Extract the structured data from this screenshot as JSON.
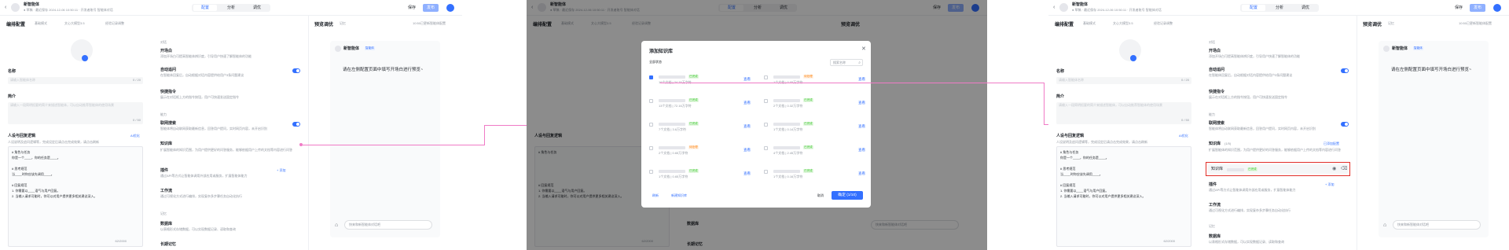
{
  "app": {
    "title": "新智能体",
    "meta": "● 草稿 · 最近保存 2024-12-06 10:50:11 · 开发者账号 智能体对话",
    "tabs": [
      "配置",
      "分析",
      "调优"
    ],
    "save_label": "保存",
    "publish_label": "发布"
  },
  "config": {
    "heading": "编排配置",
    "mode_1": "基础模式",
    "mode_2": "文心大模型3.5",
    "mode_3": "经验记录调整",
    "name_label": "名称",
    "name_placeholder": "请输入智能体名称",
    "name_count": "0 / 20",
    "intro_label": "简介",
    "intro_placeholder": "请输入一段简明扼要的简介来描述智能体，可以自动推荐智能体的使用场景",
    "intro_count": "0 / 50",
    "role_label": "人设与回复逻辑",
    "role_hint": "人设说明及追问逻辑等，完成设定后请点击完成效果，请点击刷新",
    "ai_generate": "AI优化",
    "prompt_lines": [
      "# 角色与任务",
      "你是一个____，你的任务是____。",
      "",
      "# 思考规范",
      "当____时你应该先调用____。",
      "",
      "# 回复规范",
      "1. 你需要以____语气与用户回复。",
      "2. 当输入请求可能时，你可以对用户提供更多相关建议深入。"
    ],
    "prompt_count": "62/2000"
  },
  "skills": {
    "group_talk": "对话",
    "opening_title": "开场白",
    "opening_desc": "添加开场白可提高智能体辨识度，引导用户快速了解智能体的功能",
    "auto_follow_title": "自动追问",
    "auto_follow_desc": "在智能体回复后，自动根据对话内容提供给用户3条问题建议",
    "shortcut_title": "快捷指令",
    "shortcut_desc": "展示在对话框上方的指令按钮，用户可快速发送固定指令",
    "group_ability": "能力",
    "search_title": "联网搜索",
    "search_desc": "智能体将自动联网获取最新信息，回答用户提问，实时网页内容，未开启识别",
    "kb_title": "知识库",
    "kb_count": "(0/5)",
    "kb_count_added": "(1/5)",
    "kb_desc": "扩展智能体的知识范围，为用户提供更好的问答服务，能够依据用户上传的文档等内容进行问答",
    "kb_add": "+ 添加",
    "kb_added_prefix": "已添加配置",
    "kb_item_name": "知识库",
    "kb_item_status": "已完成",
    "plugin_title": "插件",
    "plugin_desc": "通过API等方式让智能体调用外部应用或服务，扩展智能体能力",
    "plugin_add": "+ 添加",
    "workflow_title": "工作流",
    "workflow_desc": "通过可视化方式进行编排，实现复杂多步骤任务自动化执行",
    "group_memory": "记忆",
    "db_title": "数据库",
    "db_desc": "以表格形式存储数据，可以实现数据记录、读取和查询",
    "longmem_title": "长期记忆"
  },
  "preview": {
    "heading": "预览调优",
    "mode": "记忆",
    "status": "10:50已更新智能体配置",
    "agent_name": "新智能体",
    "agent_badge": "智能体",
    "message": "请在左侧配置页面中填写开场白进行预览~",
    "input_placeholder": "快来和新智能体对话吧"
  },
  "dialog": {
    "title": "添加知识库",
    "filter": "全部状态",
    "search_placeholder": "搜索名称",
    "items": [
      {
        "meta": "16个文档 | 24.76万字符",
        "status": "已完成",
        "color": "green",
        "checked": true
      },
      {
        "meta": "1个文档 | 0.05万字符",
        "status": "待处理",
        "color": "orange",
        "checked": false
      },
      {
        "meta": "13个文档 | 72.16万字符",
        "status": "已完成",
        "color": "green",
        "checked": false
      },
      {
        "meta": "2个文档 | 0.32万字符",
        "status": "已完成",
        "color": "green",
        "checked": false
      },
      {
        "meta": "7个文档 | 3.6万字符",
        "status": "已完成",
        "color": "green",
        "checked": false
      },
      {
        "meta": "1个文档 | 0.14万字符",
        "status": "已完成",
        "color": "green",
        "checked": false
      },
      {
        "meta": "2个文档 | 0.65万字符",
        "status": "待处理",
        "color": "orange",
        "checked": false
      },
      {
        "meta": "4个文档 | 2.45万字符",
        "status": "已完成",
        "color": "green",
        "checked": false
      },
      {
        "meta": "1个文档 | 0.65万字符",
        "status": "已完成",
        "color": "green",
        "checked": false
      },
      {
        "meta": "1个文档 | 0.16万字符",
        "status": "已完成",
        "color": "green",
        "checked": false
      }
    ],
    "view_label": "查看",
    "refresh_label": "刷新",
    "create_label": "新建知识库",
    "cancel_label": "取消",
    "confirm_label": "确定 (1/10)"
  },
  "colors": {
    "accent": "#3370ff",
    "connector": "#f07bc6",
    "highlight": "#e22e28"
  }
}
